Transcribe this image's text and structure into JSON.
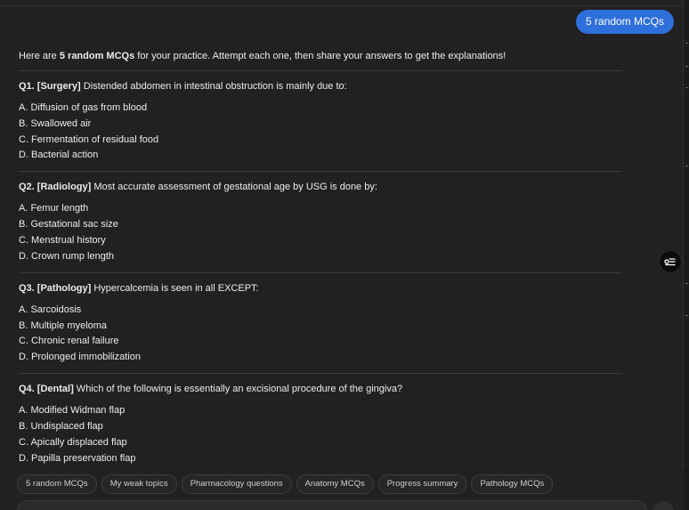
{
  "chat": {
    "user_message": "5 random MCQs",
    "intro_before": "Here are ",
    "intro_bold": "5 random MCQs",
    "intro_after": " for your practice. Attempt each one, then share your answers to get the explanations!"
  },
  "questions": [
    {
      "number": "Q1.",
      "tag": "[Surgery]",
      "text": " Distended abdomen in intestinal obstruction is mainly due to:",
      "options": [
        "A. Diffusion of gas from blood",
        "B. Swallowed air",
        "C. Fermentation of residual food",
        "D. Bacterial action"
      ]
    },
    {
      "number": "Q2.",
      "tag": "[Radiology]",
      "text": " Most accurate assessment of gestational age by USG is done by:",
      "options": [
        "A. Femur length",
        "B. Gestational sac size",
        "C. Menstrual history",
        "D. Crown rump length"
      ]
    },
    {
      "number": "Q3.",
      "tag": "[Pathology]",
      "text": " Hypercalcemia is seen in all EXCEPT:",
      "options": [
        "A. Sarcoidosis",
        "B. Multiple myeloma",
        "C. Chronic renal failure",
        "D. Prolonged immobilization"
      ]
    },
    {
      "number": "Q4.",
      "tag": "[Dental]",
      "text": " Which of the following is essentially an excisional procedure of the gingiva?",
      "options": [
        "A. Modified Widman flap",
        "B. Undisplaced flap",
        "C. Apically displaced flap",
        "D. Papilla preservation flap"
      ]
    }
  ],
  "suggestions": [
    "5 random MCQs",
    "My weak topics",
    "Pharmacology questions",
    "Anatomy MCQs",
    "Progress summary",
    "Pathology MCQs"
  ],
  "icons": {
    "float_button": "list-filter-icon",
    "send": "send-icon"
  },
  "colors": {
    "background": "#212121",
    "user_bubble": "#2f6fdc",
    "text": "#ececec"
  }
}
